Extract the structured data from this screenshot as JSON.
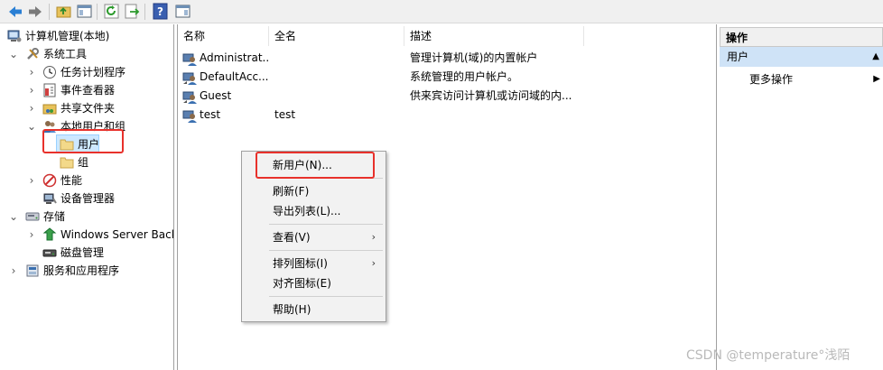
{
  "toolbar": {
    "buttons": [
      "back-icon",
      "forward-icon",
      "up-folder-icon",
      "show-hide-tree-icon",
      "refresh-icon",
      "export-list-icon",
      "help-icon",
      "show-hide-action-pane-icon"
    ]
  },
  "tree": {
    "root": "计算机管理(本地)",
    "system_tools": "系统工具",
    "task_scheduler": "任务计划程序",
    "event_viewer": "事件查看器",
    "shared_folders": "共享文件夹",
    "local_users_groups": "本地用户和组",
    "users": "用户",
    "groups": "组",
    "performance": "性能",
    "device_manager": "设备管理器",
    "storage": "存储",
    "windows_server_backup": "Windows Server Back",
    "disk_management": "磁盘管理",
    "services_apps": "服务和应用程序"
  },
  "list": {
    "columns": [
      "名称",
      "全名",
      "描述"
    ],
    "rows": [
      {
        "name": "Administrat...",
        "fullname": "",
        "description": "管理计算机(域)的内置帐户"
      },
      {
        "name": "DefaultAcc...",
        "fullname": "",
        "description": "系统管理的用户帐户。"
      },
      {
        "name": "Guest",
        "fullname": "",
        "description": "供来宾访问计算机或访问域的内..."
      },
      {
        "name": "test",
        "fullname": "test",
        "description": ""
      }
    ]
  },
  "context_menu": {
    "new_user": "新用户(N)...",
    "refresh": "刷新(F)",
    "export_list": "导出列表(L)...",
    "view": "查看(V)",
    "arrange_icons": "排列图标(I)",
    "line_up_icons": "对齐图标(E)",
    "help": "帮助(H)",
    "submenu_arrow": "›"
  },
  "actions": {
    "title": "操作",
    "section": "用户",
    "more_actions": "更多操作",
    "collapse_caret": "▲",
    "more_caret": "▶"
  },
  "watermark": "CSDN @temperature°浅陌",
  "colors": {
    "highlight_box": "#e8312b",
    "selection": "#cde8ff",
    "action_section": "#cfe3f7"
  }
}
